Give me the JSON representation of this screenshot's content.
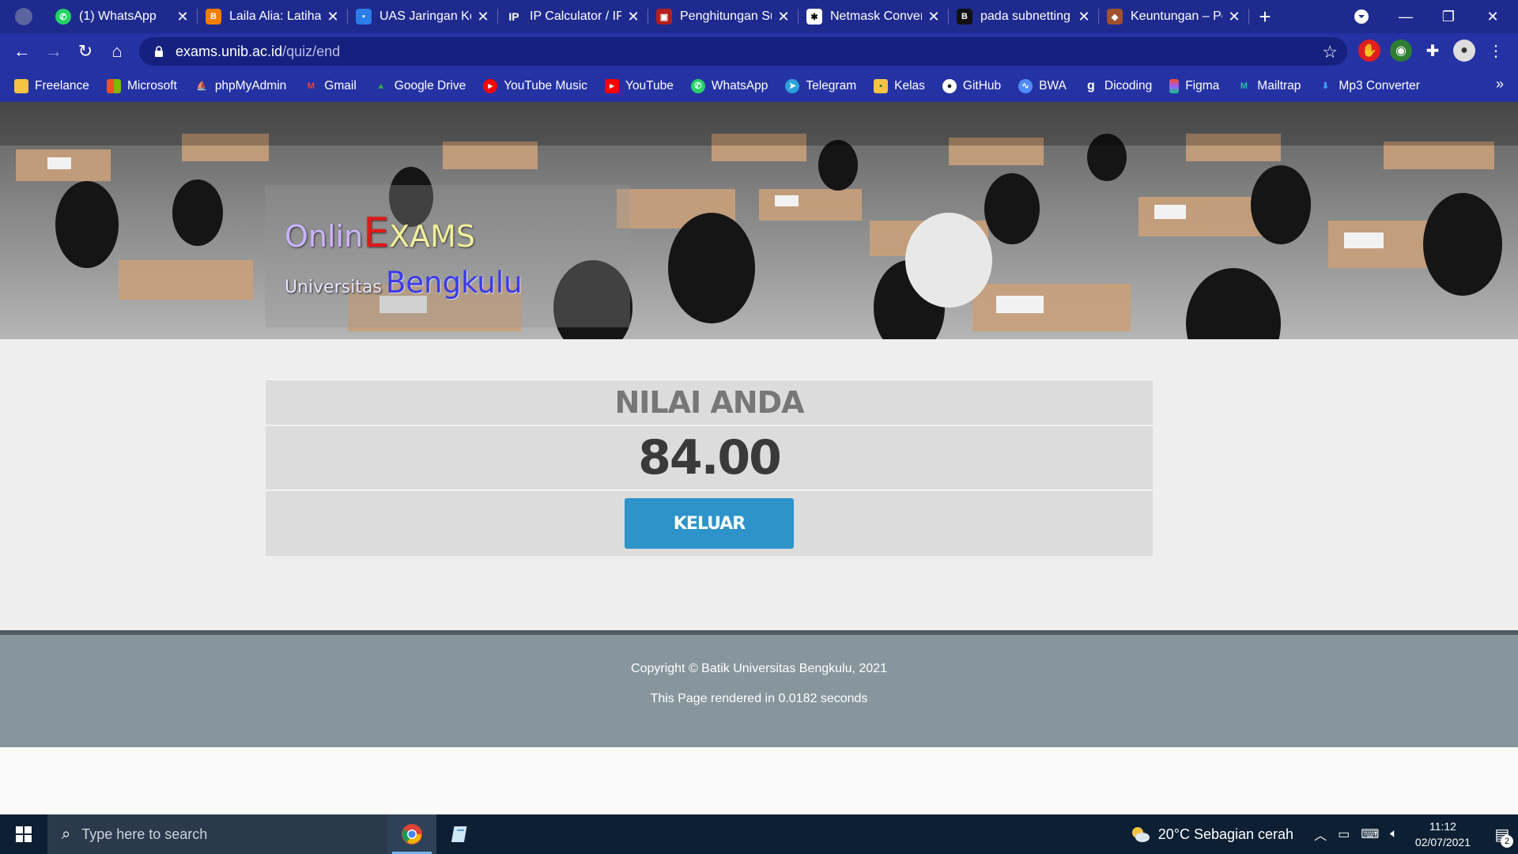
{
  "browser": {
    "tabs": [
      {
        "title": "(1) WhatsApp",
        "icon": "whatsapp-icon",
        "color": "#25d366"
      },
      {
        "title": "Laila Alia: Latihan",
        "icon": "blogger-icon",
        "color": "#f57d00"
      },
      {
        "title": "UAS Jaringan Kom",
        "icon": "classroom-icon",
        "color": "#2b7de9"
      },
      {
        "title": "IP Calculator / IP",
        "icon": "ip-icon",
        "color": "#1f2a8f"
      },
      {
        "title": "Penghitungan Su",
        "icon": "site-icon",
        "color": "#b32020"
      },
      {
        "title": "Netmask Conver",
        "icon": "netmask-icon",
        "color": "#ffffff"
      },
      {
        "title": "pada subnetting",
        "icon": "b-icon",
        "color": "#111111"
      },
      {
        "title": "Keuntungan – Pe",
        "icon": "site-icon",
        "color": "#a0522d"
      }
    ],
    "tab_close": "✕",
    "new_tab": "+",
    "address": {
      "host": "exams.unib.ac.id",
      "path": "/quiz/end"
    },
    "bookmarks": [
      {
        "label": "Freelance",
        "icon": "folder-icon",
        "color": "#f6c343"
      },
      {
        "label": "Microsoft",
        "icon": "microsoft-icon",
        "color": "#f25022"
      },
      {
        "label": "phpMyAdmin",
        "icon": "phpmyadmin-icon",
        "color": "#f29111"
      },
      {
        "label": "Gmail",
        "icon": "gmail-icon",
        "color": "#ea4335"
      },
      {
        "label": "Google Drive",
        "icon": "drive-icon",
        "color": "#34a853"
      },
      {
        "label": "YouTube Music",
        "icon": "youtube-music-icon",
        "color": "#ff0000"
      },
      {
        "label": "YouTube",
        "icon": "youtube-icon",
        "color": "#ff0000"
      },
      {
        "label": "WhatsApp",
        "icon": "whatsapp-icon",
        "color": "#25d366"
      },
      {
        "label": "Telegram",
        "icon": "telegram-icon",
        "color": "#2aa1da"
      },
      {
        "label": "Kelas",
        "icon": "classroom-icon",
        "color": "#f6c343"
      },
      {
        "label": "GitHub",
        "icon": "github-icon",
        "color": "#ffffff"
      },
      {
        "label": "BWA",
        "icon": "bwa-icon",
        "color": "#4f8cff"
      },
      {
        "label": "Dicoding",
        "icon": "dicoding-icon",
        "color": "#ffffff"
      },
      {
        "label": "Figma",
        "icon": "figma-icon",
        "color": "#f24e1e"
      },
      {
        "label": "Mailtrap",
        "icon": "mailtrap-icon",
        "color": "#22c3a6"
      },
      {
        "label": "Mp3 Converter",
        "icon": "mp3-converter-icon",
        "color": "#3aa0ff"
      }
    ],
    "more": "»"
  },
  "page": {
    "brand": {
      "onlin": "Onlin",
      "e": "E",
      "xams": "XAMS",
      "univ": "Universitas",
      "city": "Bengkulu"
    },
    "result": {
      "title": "NILAI ANDA",
      "score": "84.00",
      "button": "KELUAR"
    },
    "footer": {
      "copyright": "Copyright © Batik Universitas Bengkulu, 2021",
      "render_time": "This Page rendered in 0.0182 seconds"
    }
  },
  "taskbar": {
    "search_placeholder": "Type here to search",
    "weather": "20°C  Sebagian cerah",
    "time": "11:12",
    "date": "02/07/2021",
    "notifications": "2"
  },
  "colors": {
    "accent": "#2d93c9",
    "chrome": "#1f2a8f",
    "footer": "#87969d"
  }
}
